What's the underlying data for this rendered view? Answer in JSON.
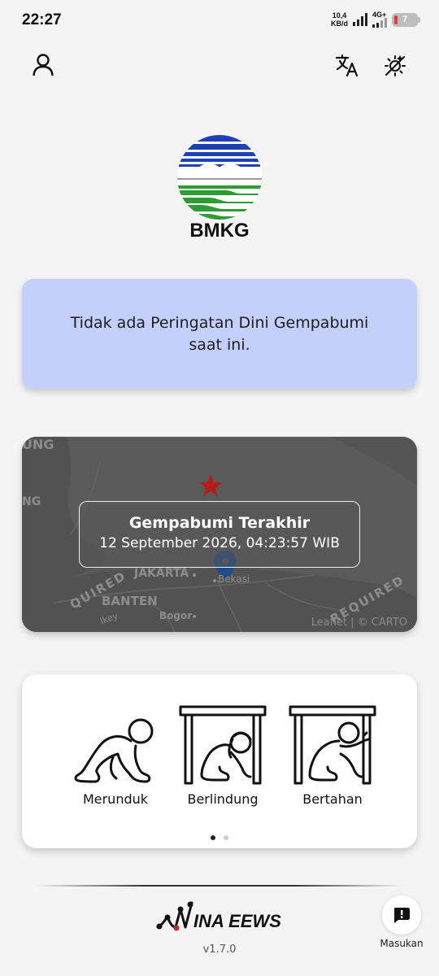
{
  "status_bar": {
    "time": "22:27",
    "net_speed_value": "10,4",
    "net_speed_unit": "KB/d",
    "network_type": "4G+",
    "battery_level": "7"
  },
  "header": {
    "profile_icon": "person-icon",
    "translate_icon": "translate-icon",
    "theme_icon": "theme-toggle-icon"
  },
  "brand": {
    "name": "BMKG",
    "colors": {
      "blue": "#1f3fb5",
      "green": "#2e9b35"
    }
  },
  "warning": {
    "text": "Tidak ada Peringatan Dini Gempabumi saat ini.",
    "background": "#c5cffc"
  },
  "latest_quake": {
    "title": "Gempabumi Terakhir",
    "datetime": "12 September 2026, 04:23:57 WIB",
    "map_labels": {
      "top_left": "UNG",
      "mid_left": "NG",
      "jakarta": "JAKARTA",
      "bekasi": "Bekasi",
      "banten": "BANTEN",
      "bogor": "Bogor",
      "required_left": "QUIRED",
      "required_right": "REQUIRED",
      "key": "Ikey"
    },
    "attribution": "Leaflet | © CARTO"
  },
  "tips": {
    "items": [
      {
        "label": "Merunduk"
      },
      {
        "label": "Berlindung"
      },
      {
        "label": "Bertahan"
      }
    ],
    "page_index": 0,
    "page_count": 2
  },
  "footer": {
    "app_name": "INA EEWS",
    "version": "v1.7.0",
    "feedback_label": "Masukan"
  }
}
